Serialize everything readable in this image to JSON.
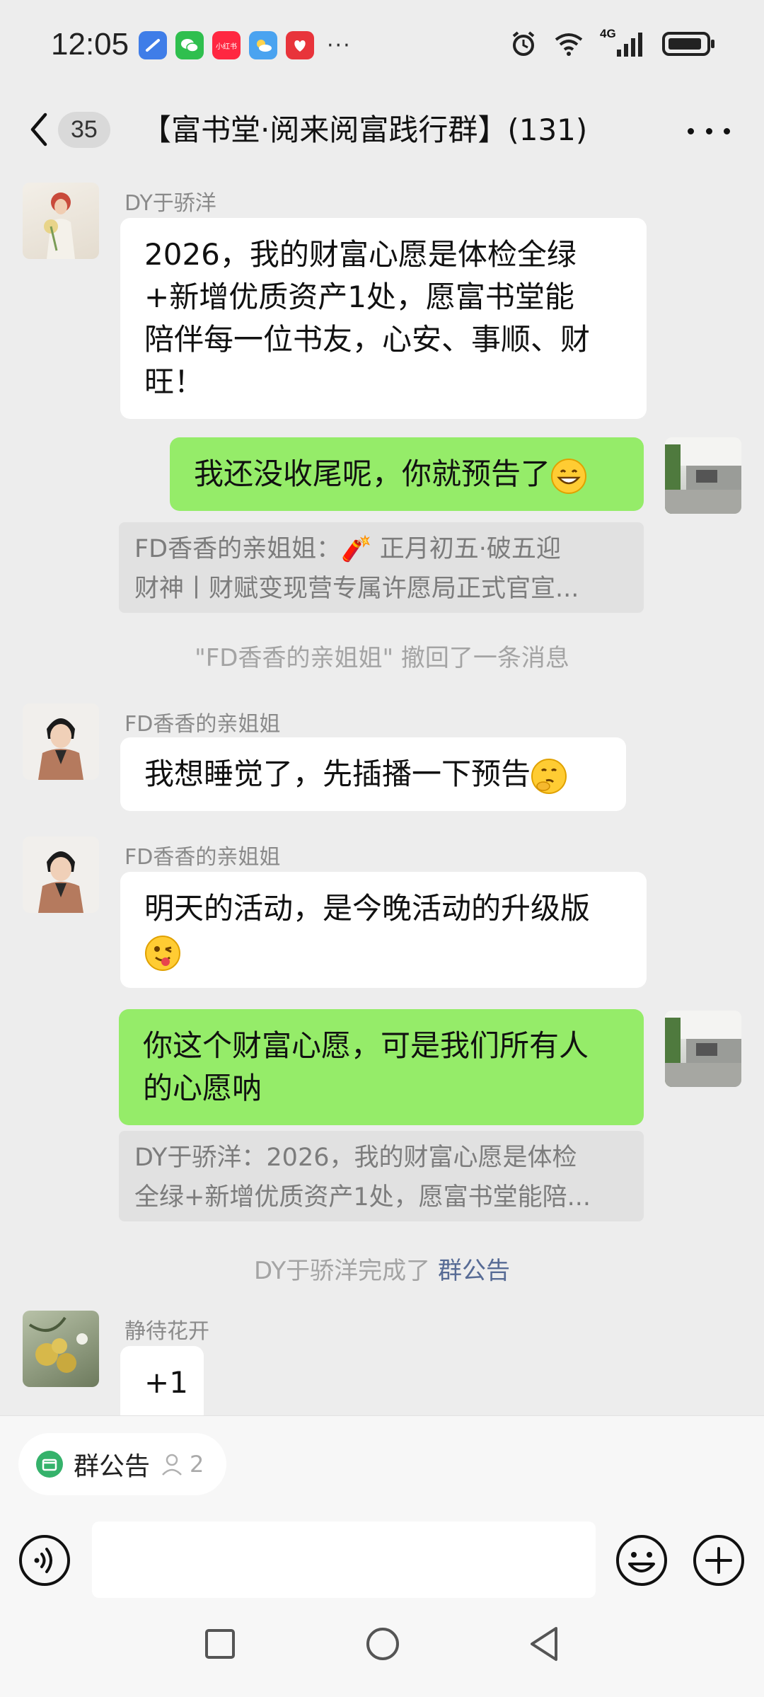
{
  "status_bar": {
    "time": "12:05",
    "more": "···",
    "network": "4G",
    "xiaohongshu_label": "小红书"
  },
  "header": {
    "unread_count": "35",
    "title": "【富书堂·阅来阅富践行群】(131)"
  },
  "messages": [
    {
      "sender": "DY于骄洋",
      "lines": [
        "2026，我的财富心愿是体检全绿",
        "+新增优质资产1处，愿富书堂能",
        "陪伴每一位书友，心安、事顺、财",
        "旺！"
      ]
    },
    {
      "text": "我还没收尾呢，你就预告了",
      "quote_lines": [
        "FD香香的亲姐姐：🧨 正月初五·破五迎",
        "财神丨财赋变现营专属许愿局正式官宣..."
      ]
    },
    {
      "system": "\"FD香香的亲姐姐\" 撤回了一条消息"
    },
    {
      "sender": "FD香香的亲姐姐",
      "text": "我想睡觉了，先插播一下预告"
    },
    {
      "sender": "FD香香的亲姐姐",
      "text": "明天的活动，是今晚活动的升级版"
    },
    {
      "lines": [
        "你这个财富心愿，可是我们所有人",
        "的心愿呐"
      ],
      "quote_lines": [
        "DY于骄洋：2026，我的财富心愿是体检",
        "全绿+新增优质资产1处，愿富书堂能陪..."
      ]
    },
    {
      "system_prefix": "DY于骄洋完成了 ",
      "system_link": "群公告"
    },
    {
      "sender": "静待花开",
      "text": "+1"
    }
  ],
  "notice": {
    "label": "群公告",
    "count": "2"
  },
  "colors": {
    "background": "#ededed",
    "own_bubble": "#95ec69",
    "other_bubble": "#ffffff",
    "link": "#576b95"
  },
  "icons": [
    "back-chevron-icon",
    "more-icon",
    "voice-icon",
    "emoji-icon",
    "plus-icon",
    "announcement-icon",
    "person-icon",
    "nav-square-icon",
    "nav-circle-icon",
    "nav-back-icon"
  ]
}
